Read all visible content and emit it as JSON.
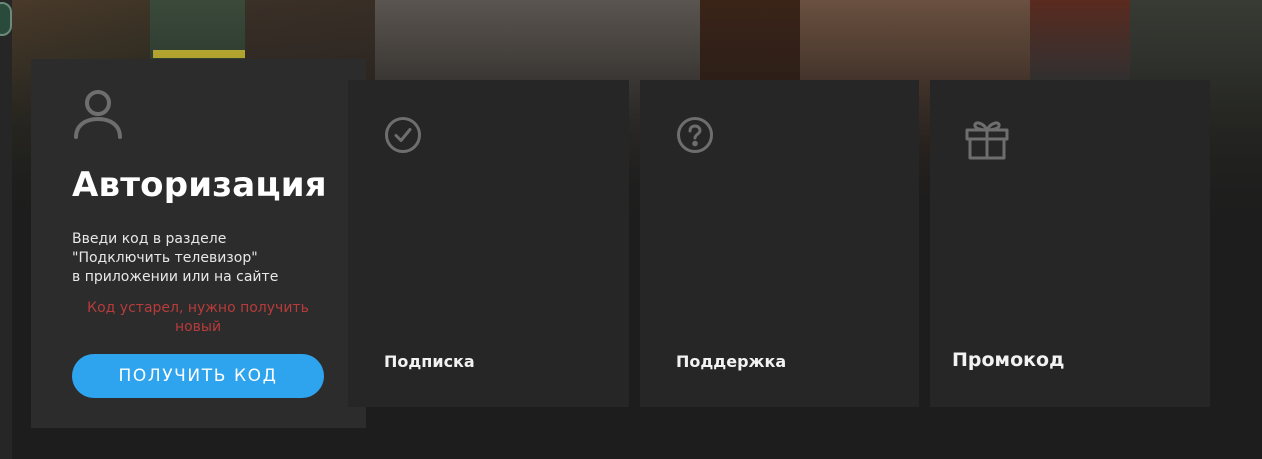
{
  "auth": {
    "title": "Авторизация",
    "description_lines": [
      "Введи код в разделе",
      "\"Подключить телевизор\"",
      "в приложении или на сайте"
    ],
    "error": "Код устарел, нужно получить новый",
    "button_label": "ПОЛУЧИТЬ КОД",
    "icon": "user-icon"
  },
  "tiles": [
    {
      "label": "Подписка",
      "icon": "check-circle-icon"
    },
    {
      "label": "Поддержка",
      "icon": "question-circle-icon"
    },
    {
      "label": "Промокод",
      "icon": "gift-icon"
    }
  ],
  "colors": {
    "background": "#1d1d1d",
    "card": "#262626",
    "active_card": "#2c2c2c",
    "accent": "#2ea3ee",
    "error": "#b83b3b",
    "icon": "#6e6e6e"
  }
}
